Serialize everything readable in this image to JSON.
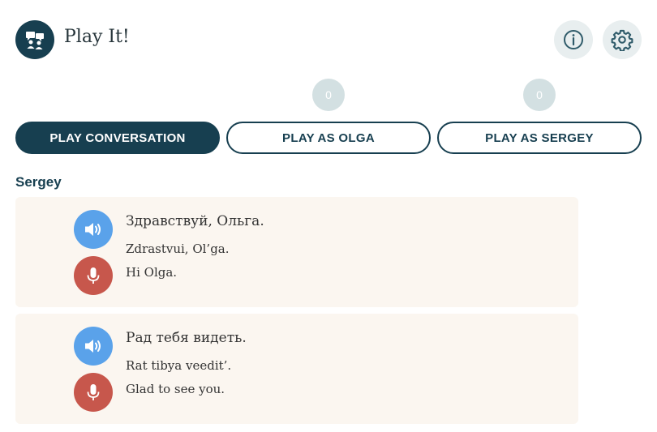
{
  "app": {
    "title": "Play It!",
    "icon": "conversation-people-icon"
  },
  "header": {
    "info_icon": "info-icon",
    "settings_icon": "gear-icon"
  },
  "scores": {
    "olga": "0",
    "sergey": "0"
  },
  "play_buttons": {
    "conversation": "PLAY CONVERSATION",
    "olga": "PLAY AS OLGA",
    "sergey": "PLAY AS SERGEY"
  },
  "speaker": "Sergey",
  "lines": [
    {
      "russian": "Здравствуй, Ольга.",
      "transliteration": "Zdrastvui, Ol’ga.",
      "english": "Hi Olga."
    },
    {
      "russian": "Рад тебя видеть.",
      "transliteration": "Rat tibya veedit’.",
      "english": "Glad to see you."
    }
  ],
  "colors": {
    "primary": "#173f50",
    "audio": "#5aa2ea",
    "mic": "#c7574c",
    "card_bg": "#fbf6f0",
    "score_bg": "#d3e0e2"
  }
}
